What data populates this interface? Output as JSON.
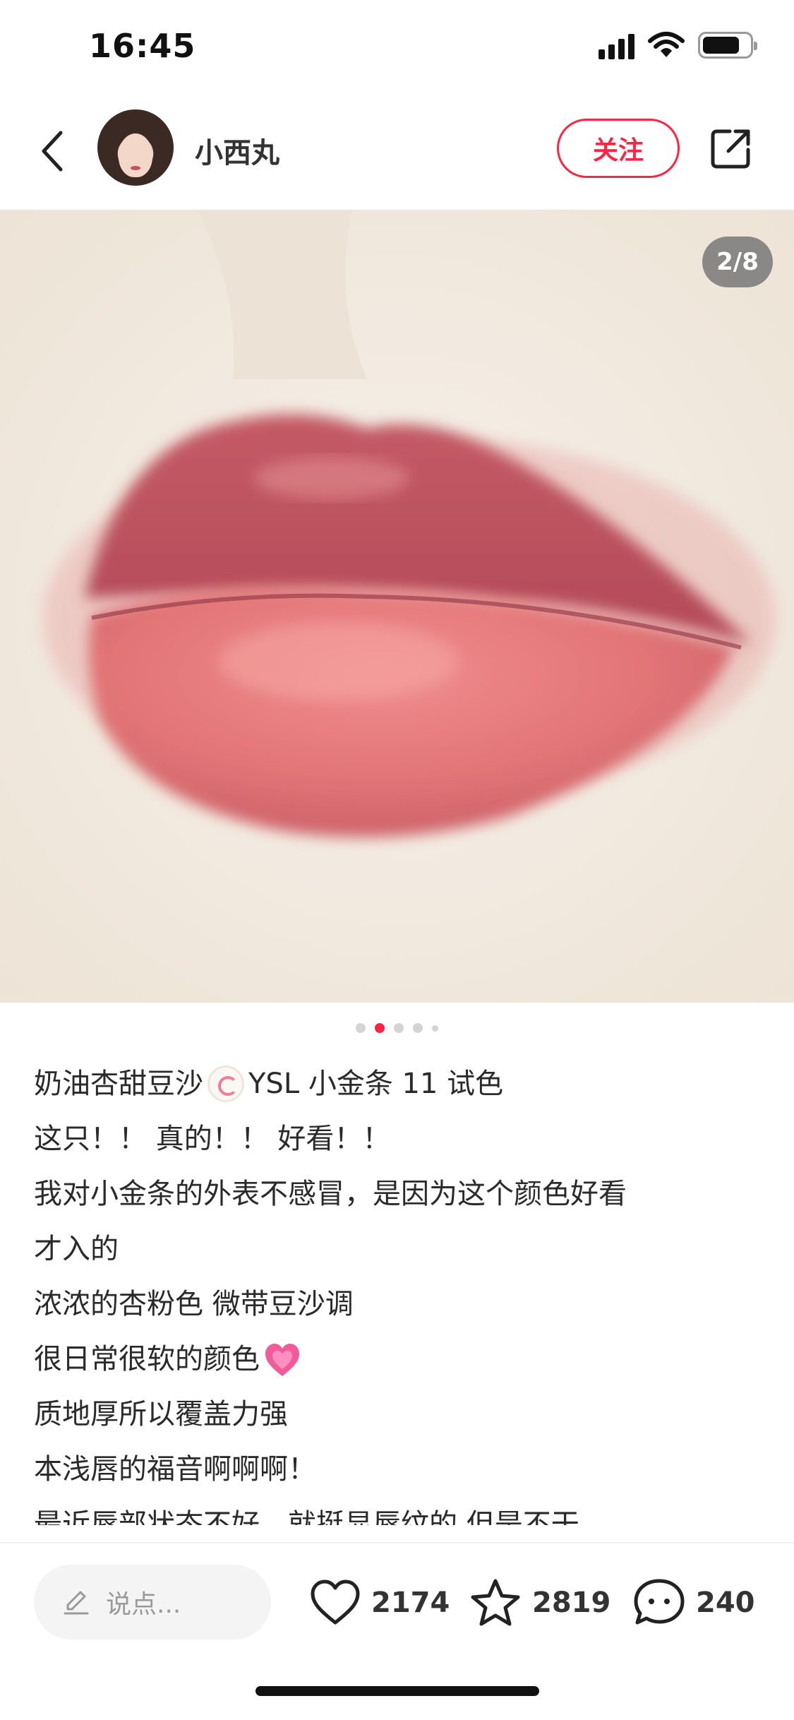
{
  "status_bar": {
    "time": "16:45",
    "icons": [
      "signal-icon",
      "wifi-icon",
      "battery-icon"
    ],
    "battery_level_percent": 80
  },
  "header": {
    "username": "小西丸",
    "follow_label": "关注",
    "icons": [
      "back-icon",
      "avatar",
      "share-icon"
    ]
  },
  "carousel": {
    "page_indicator": "2/8",
    "current_page": 2,
    "total_pages": 8,
    "visible_dots": 5,
    "active_dot_index": 1,
    "image_subject": "lip swatch photo"
  },
  "post": {
    "title_before": "奶油杏甜豆沙",
    "title_emoji": "narutomaki-emoji",
    "title_after": "YSL 小金条 11 试色",
    "lines": [
      "这只！！ 真的！！ 好看！！",
      "我对小金条的外表不感冒，是因为这个颜色好看",
      "才入的",
      "浓浓的杏粉色 微带豆沙调"
    ],
    "heart_line": "很日常很软的颜色",
    "heart_emoji": "growing-heart-emoji",
    "lines_after": [
      "质地厚所以覆盖力强",
      "本浅唇的福音啊啊啊！",
      "最近唇部状态不好，就挺显唇纹的 但是不干"
    ]
  },
  "bottom_bar": {
    "comment_placeholder": "说点...",
    "like_count": "2174",
    "collect_count": "2819",
    "comment_count": "240"
  },
  "colors": {
    "accent": "#ff2442",
    "text": "#2a2a2a",
    "muted": "#9a9a9a",
    "lip": "#d9707a"
  }
}
